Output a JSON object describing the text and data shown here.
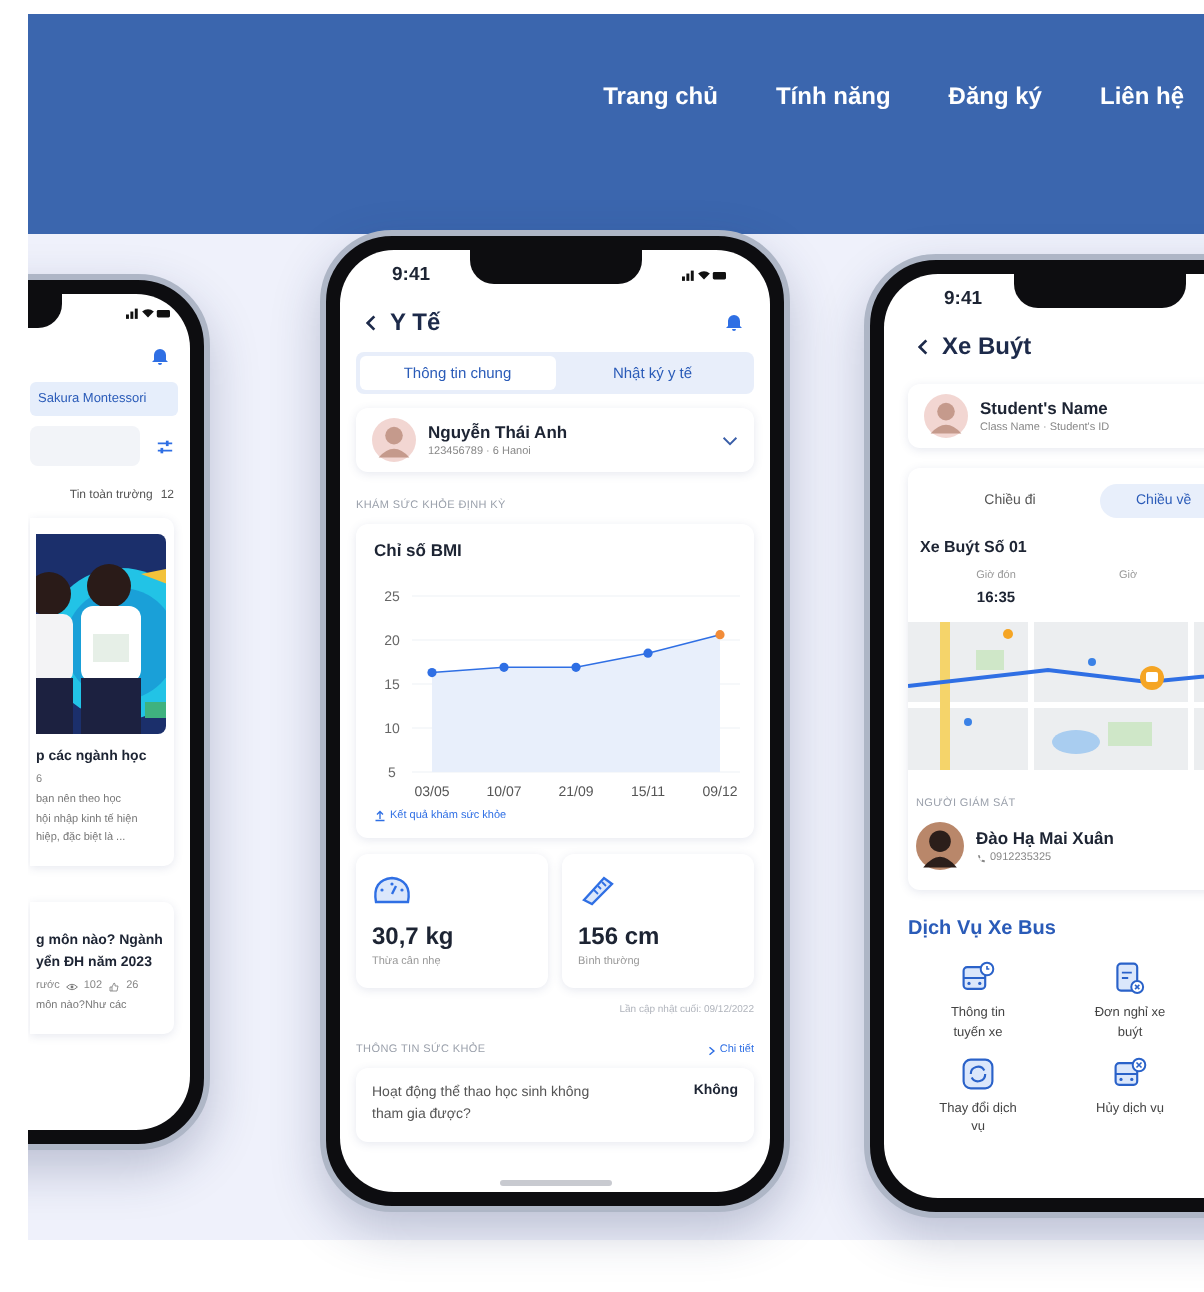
{
  "nav": [
    {
      "label": "Trang chủ"
    },
    {
      "label": "Tính năng"
    },
    {
      "label": "Đăng ký"
    },
    {
      "label": "Liên hệ"
    }
  ],
  "news_phone": {
    "school": "Sakura Montessori",
    "feed_label": "Tin toàn trường",
    "feed_count": "12",
    "articles": [
      {
        "kind": "featured",
        "title_lines": [
          "p các ngành học"
        ],
        "meta": "6",
        "excerpt_lines": [
          "bạn nên theo học",
          "hội nhập kinh tế hiện",
          "hiệp, đặc biệt là ..."
        ]
      },
      {
        "kind": "compact",
        "title_lines": [
          "g môn nào? Ngành",
          "yển ĐH năm 2023"
        ],
        "meta": "rước",
        "views": "102",
        "likes": "26",
        "excerpt_lines": [
          "môn nào?Như các"
        ]
      }
    ]
  },
  "health_phone": {
    "time": "9:41",
    "title": "Y Tế",
    "tabs": [
      {
        "label": "Thông tin chung",
        "selected": true
      },
      {
        "label": "Nhật ký y tế",
        "selected": false
      }
    ],
    "profile": {
      "name": "Nguyễn Thái Anh",
      "meta": "123456789 · 6 Hanoi"
    },
    "checkup_label": "KHÁM SỨC KHỎE ĐỊNH KỲ",
    "bmi_card": {
      "title": "Chỉ số BMI",
      "link": "Kết quả khám sức khỏe",
      "chart_data": {
        "type": "line",
        "categories": [
          "03/05",
          "10/07",
          "21/09",
          "15/11",
          "09/12"
        ],
        "series": [
          {
            "color": "#2f6fe4",
            "marker": "circle",
            "values": [
              16.3,
              16.9,
              16.9,
              18.5,
              20.6
            ]
          }
        ],
        "grid": true,
        "ylim": [
          5,
          25
        ],
        "yticks": [
          5,
          10,
          15,
          20,
          25
        ]
      }
    },
    "stats": [
      {
        "kind": "weight",
        "value": "30,7 kg",
        "note": "Thừa cân nhẹ"
      },
      {
        "kind": "height",
        "value": "156 cm",
        "note": "Bình thường"
      }
    ],
    "updated": "Lần cập nhật cuối: 09/12/2022",
    "info_label": "THÔNG TIN SỨC KHỎE",
    "info_link": "Chi tiết",
    "questions": [
      {
        "text": "Hoạt động thể thao học sinh không tham gia được?",
        "answer": "Không"
      }
    ]
  },
  "bus_phone": {
    "time": "9:41",
    "title": "Xe Buýt",
    "student": {
      "name": "Student's Name",
      "meta": "Class Name · Student's ID"
    },
    "directions": [
      {
        "label": "Chiều đi",
        "selected": false
      },
      {
        "label": "Chiều về",
        "selected": true
      }
    ],
    "bus_name": "Xe Buýt Số 01",
    "times": [
      {
        "label": "Giờ đón",
        "value": "16:35"
      },
      {
        "label": "Giờ"
      }
    ],
    "supervisor": {
      "label": "NGƯỜI GIÁM SÁT",
      "name": "Đào Hạ Mai Xuân",
      "phone": "0912235325"
    },
    "services_title": "Dịch Vụ Xe Bus",
    "services": [
      {
        "kind": "route",
        "label": "Thông tin tuyến xe"
      },
      {
        "kind": "leave",
        "label": "Đơn nghỉ xe buýt"
      },
      {
        "kind": "change",
        "label": "Thay đổi dịch vụ"
      },
      {
        "kind": "cancel",
        "label": "Hủy dịch vụ"
      }
    ]
  }
}
